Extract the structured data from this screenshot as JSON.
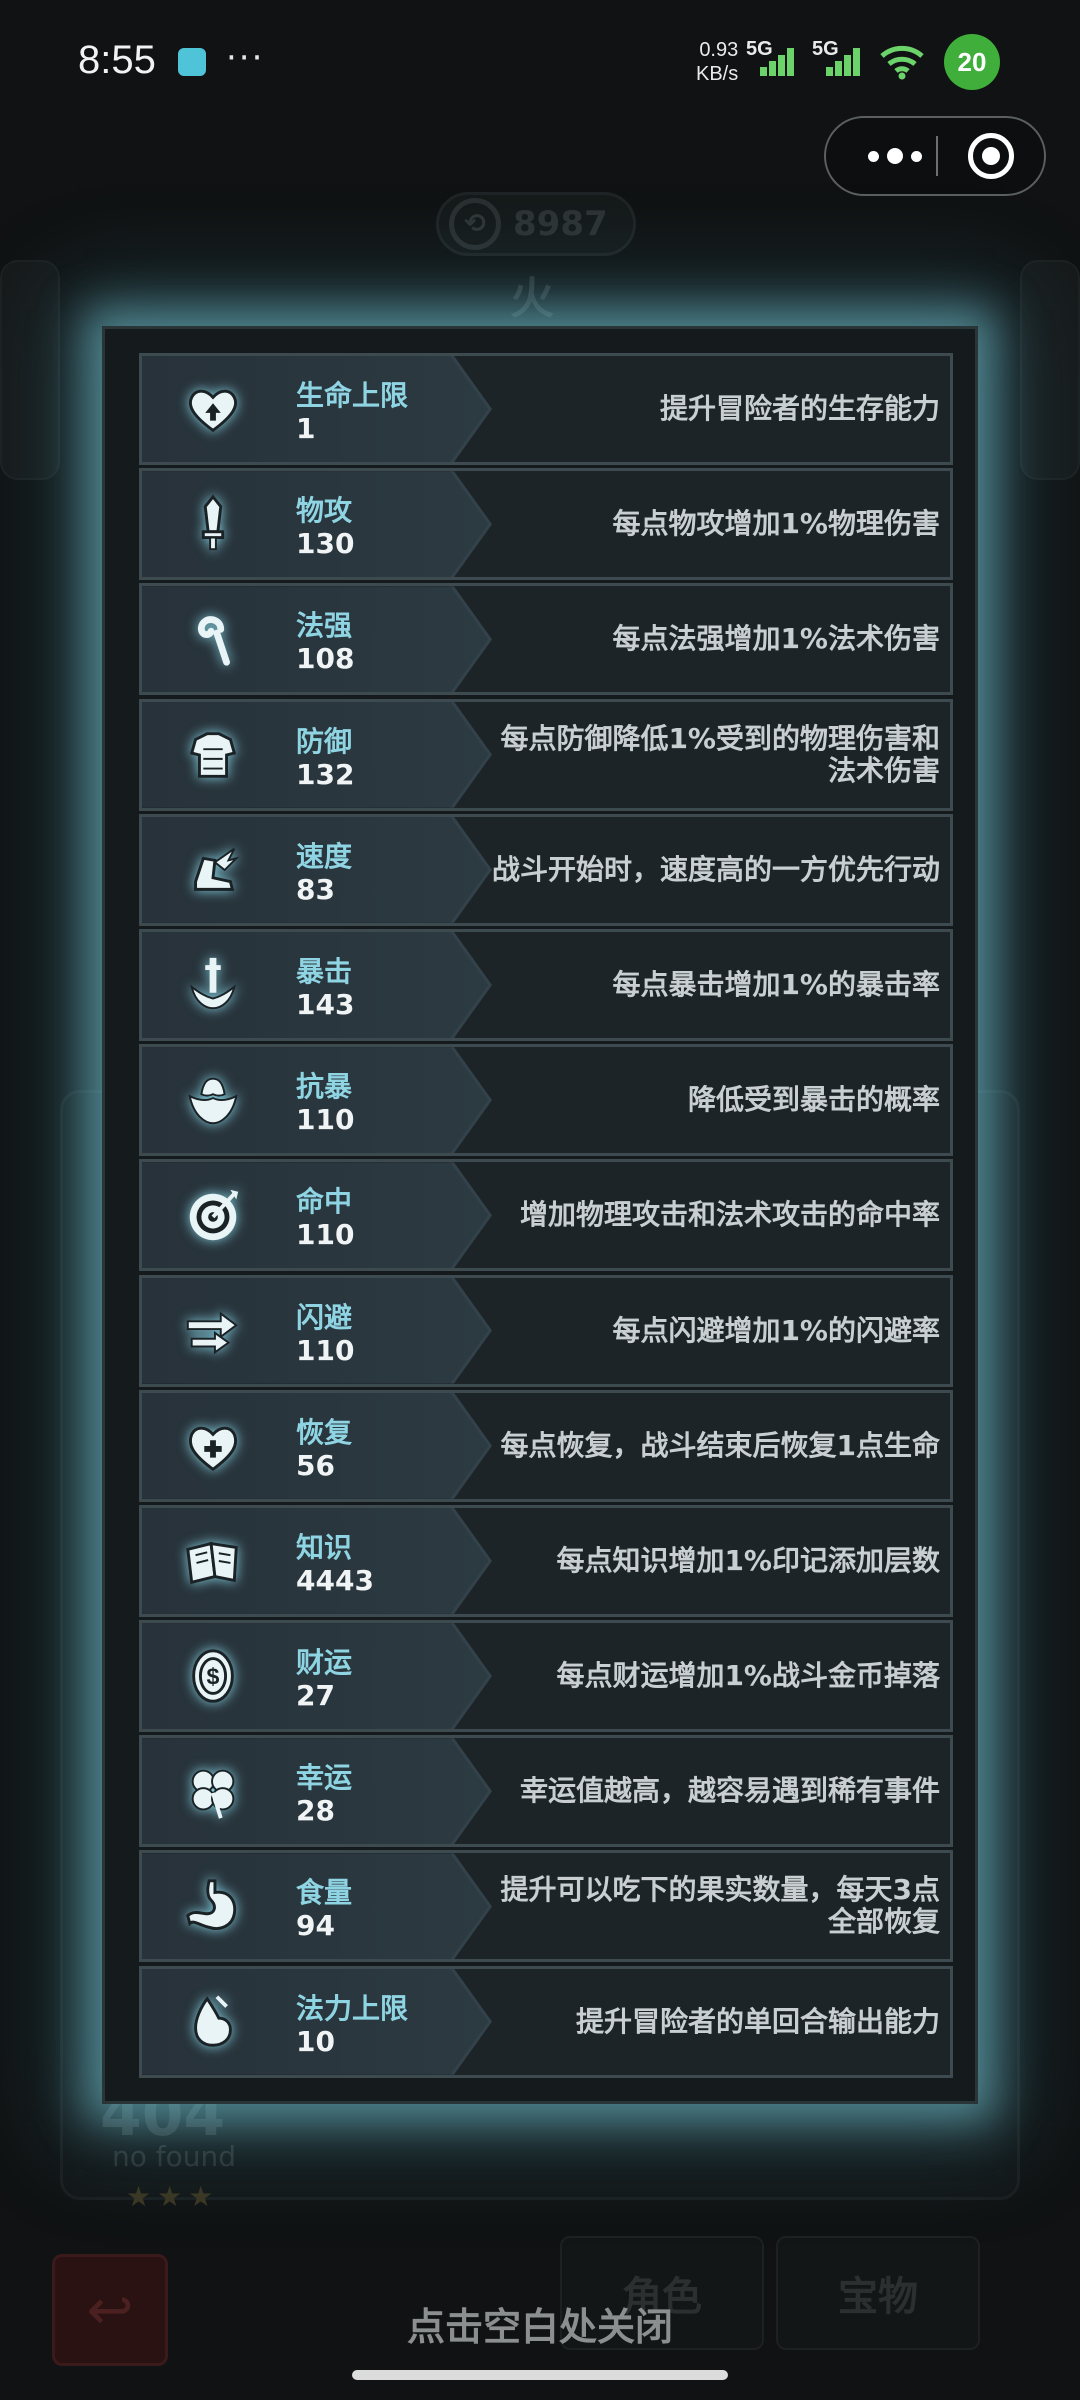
{
  "status_bar": {
    "time": "8:55",
    "more": "···",
    "net_speed_value": "0.93",
    "net_speed_unit": "KB/s",
    "sim1_label": "5G",
    "sim2_label": "5G",
    "badge": "20"
  },
  "background": {
    "currency_value": "8987",
    "element_label": "火",
    "tab_role": "角色",
    "tab_treasure": "宝物",
    "placeholder_big": "404",
    "placeholder_small": "no found",
    "stars": "★★★"
  },
  "stats": [
    {
      "name": "生命上限",
      "value": "1",
      "desc": "提升冒险者的生存能力",
      "icon": "heart-up-icon"
    },
    {
      "name": "物攻",
      "value": "130",
      "desc": "每点物攻增加1%物理伤害",
      "icon": "sword-icon"
    },
    {
      "name": "法强",
      "value": "108",
      "desc": "每点法强增加1%法术伤害",
      "icon": "staff-icon"
    },
    {
      "name": "防御",
      "value": "132",
      "desc": "每点防御降低1%受到的物理伤害和法术伤害",
      "icon": "armor-icon"
    },
    {
      "name": "速度",
      "value": "83",
      "desc": "战斗开始时，速度高的一方优先行动",
      "icon": "winged-boot-icon"
    },
    {
      "name": "暴击",
      "value": "143",
      "desc": "每点暴击增加1%的暴击率",
      "icon": "crit-dagger-icon"
    },
    {
      "name": "抗暴",
      "value": "110",
      "desc": "降低受到暴击的概率",
      "icon": "shell-shield-icon"
    },
    {
      "name": "命中",
      "value": "110",
      "desc": "增加物理攻击和法术攻击的命中率",
      "icon": "target-icon"
    },
    {
      "name": "闪避",
      "value": "110",
      "desc": "每点闪避增加1%的闪避率",
      "icon": "dodge-arrows-icon"
    },
    {
      "name": "恢复",
      "value": "56",
      "desc": "每点恢复，战斗结束后恢复1点生命",
      "icon": "heart-plus-icon"
    },
    {
      "name": "知识",
      "value": "4443",
      "desc": "每点知识增加1%印记添加层数",
      "icon": "book-icon"
    },
    {
      "name": "财运",
      "value": "27",
      "desc": "每点财运增加1%战斗金币掉落",
      "icon": "coin-icon"
    },
    {
      "name": "幸运",
      "value": "28",
      "desc": "幸运值越高，越容易遇到稀有事件",
      "icon": "clover-icon"
    },
    {
      "name": "食量",
      "value": "94",
      "desc": "提升可以吃下的果实数量，每天3点全部恢复",
      "icon": "stomach-icon"
    },
    {
      "name": "法力上限",
      "value": "10",
      "desc": "提升冒险者的单回合输出能力",
      "icon": "mana-drop-icon"
    }
  ],
  "footer": {
    "close_hint": "点击空白处关闭"
  },
  "colors": {
    "accent_glow": "#78c8d7",
    "stat_name": "#8fd4e2",
    "stat_value": "#f0f4f5",
    "description": "#c9cfd1"
  }
}
